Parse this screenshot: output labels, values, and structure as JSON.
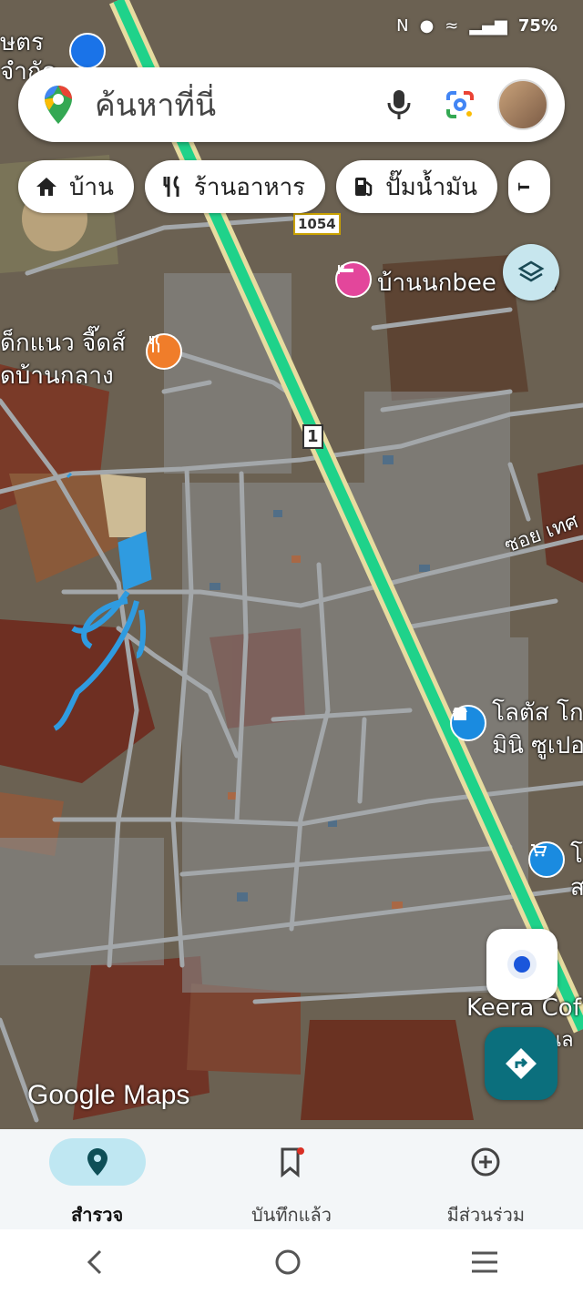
{
  "status": {
    "battery": "75%"
  },
  "search": {
    "placeholder": "ค้นหาที่นี่"
  },
  "chips": [
    {
      "label": "บ้าน",
      "icon": "home-icon"
    },
    {
      "label": "ร้านอาหาร",
      "icon": "restaurant-icon"
    },
    {
      "label": "ปั๊มน้ำมัน",
      "icon": "gas-station-icon"
    }
  ],
  "map": {
    "labels": {
      "top_left_1": "ษตร",
      "top_left_2": "จำกัด",
      "hotel": "บ้านนกbee view",
      "restaurant_1": "ด็กแนว จี๊ดส์",
      "restaurant_2": "ดบ้านกลาง",
      "soi": "ซอย เทศ",
      "lotus_1": "โลตัส โก",
      "lotus_2": "มินิ ซูเปอ",
      "shop_1": "โล",
      "shop_2": "ส",
      "keera_1": "Keera Cof",
      "keera_2": "ท่าแนล"
    },
    "routes": {
      "r1054": "1054",
      "r1": "1"
    },
    "watermark": "Google Maps",
    "colors": {
      "highway": "#1fd28a",
      "road": "#9ea3a6",
      "drawing": "#2f9be0"
    }
  },
  "nav": {
    "tabs": [
      {
        "label": "สำรวจ",
        "icon": "explore-pin-icon",
        "active": true
      },
      {
        "label": "บันทึกแล้ว",
        "icon": "bookmark-icon",
        "active": false
      },
      {
        "label": "มีส่วนร่วม",
        "icon": "add-circle-icon",
        "active": false
      }
    ]
  }
}
